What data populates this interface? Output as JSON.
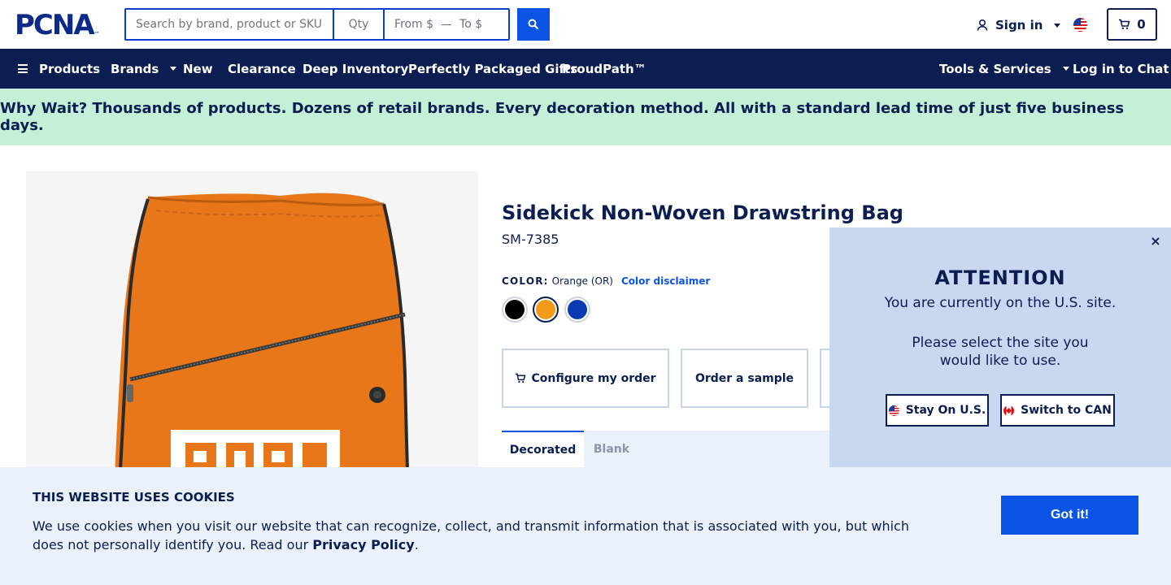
{
  "header": {
    "logo_text": "PCNA",
    "logo_tm": "™",
    "search": {
      "placeholder": "Search by brand, product or SKU"
    },
    "qty": {
      "placeholder": "Qty"
    },
    "price": {
      "from_placeholder": "From $",
      "to_placeholder": "To $"
    },
    "search_button_icon": "search-icon",
    "signin_label": "Sign in",
    "cart_count": "0"
  },
  "nav": {
    "products_label": "Products",
    "brands_label": "Brands",
    "new_label": "New",
    "clearance_label": "Clearance",
    "deep_inventory_label": "Deep Inventory",
    "gifts_label": "Perfectly Packaged Gifts",
    "proudpath_label": "ProudPath™",
    "tools_label": "Tools & Services",
    "chat_label": "Log in to Chat"
  },
  "banner": {
    "text": "Why Wait? Thousands of products. Dozens of retail brands. Every decoration method. All with a standard lead time of just five business days."
  },
  "product": {
    "title": "Sidekick Non-Woven Drawstring Bag",
    "sku": "SM-7385",
    "color_label": "COLOR:",
    "color_value": "Orange (OR)",
    "color_disclaimer": "Color disclaimer",
    "swatches": [
      {
        "name": "Black",
        "hex": "#000000",
        "selected": false
      },
      {
        "name": "Orange",
        "hex": "#f29a1a",
        "selected": true
      },
      {
        "name": "Blue",
        "hex": "#0b3bb0",
        "selected": false
      }
    ],
    "configure_label": "Configure my order",
    "sample_label": "Order a sample",
    "tabs": {
      "decorated": "Decorated",
      "blank": "Blank"
    },
    "bag_color": "#e8771a",
    "imprint_text": "PERU"
  },
  "site_popup": {
    "close_label": "×",
    "title": "ATTENTION",
    "line1": "You are currently on the U.S. site.",
    "line2": "Please select the site you",
    "line3": "would like to use.",
    "stay_label": "Stay On U.S.",
    "switch_label": "Switch to CAN"
  },
  "cookie": {
    "title": "THIS WEBSITE USES COOKIES",
    "text_before": "We use cookies when you visit our website that can recognize, collect, and transmit information that is associated with you, but which does not personally identify you. Read our ",
    "link": "Privacy Policy",
    "text_after": ".",
    "button_label": "Got it!"
  },
  "colors": {
    "navy": "#0b1d51",
    "accent_blue": "#0b54e6",
    "banner_green": "#c5efd7",
    "popup_blue": "#c8d8f0"
  }
}
